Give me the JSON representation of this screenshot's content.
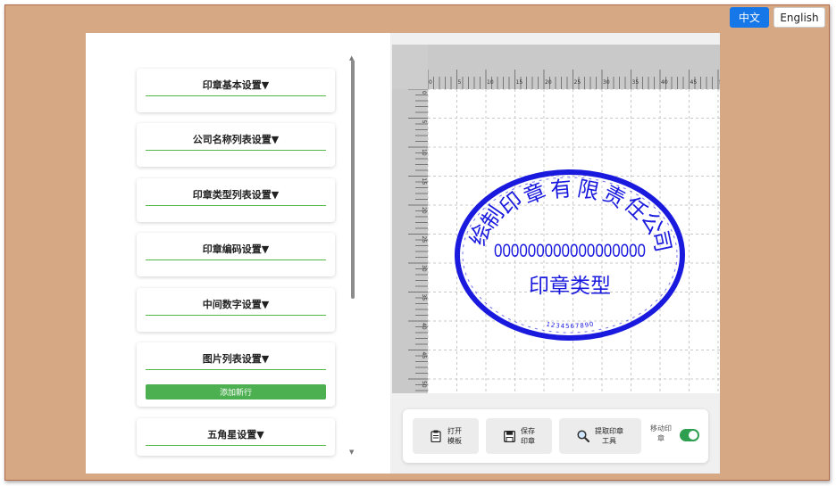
{
  "lang": {
    "zh": "中文",
    "en": "English"
  },
  "sections": [
    {
      "title": "印章基本设置▼"
    },
    {
      "title": "公司名称列表设置▼"
    },
    {
      "title": "印章类型列表设置▼"
    },
    {
      "title": "印章编码设置▼"
    },
    {
      "title": "中间数字设置▼"
    },
    {
      "title": "图片列表设置▼",
      "button": "添加新行"
    },
    {
      "title": "五角星设置▼"
    }
  ],
  "ruler": {
    "top_ticks": [
      "0",
      "5",
      "10",
      "15",
      "20",
      "25",
      "30",
      "35",
      "40",
      "45",
      "5"
    ],
    "left_ticks": [
      "0",
      "5",
      "10",
      "15",
      "20",
      "25",
      "30",
      "35",
      "40",
      "45",
      "50"
    ]
  },
  "stamp": {
    "company_chars": [
      "绘",
      "制",
      "印",
      "章",
      "有",
      "限",
      "责",
      "任",
      "公",
      "司"
    ],
    "code": "000000000000000000",
    "type": "印章类型",
    "bottom_code": "1234567890",
    "color": "#1a1adf"
  },
  "toolbar": {
    "open": "打开\n模板",
    "save": "保存\n印章",
    "extract": "提取印章\n工具",
    "move_label": "移动印\n章",
    "move_enabled": true
  },
  "colors": {
    "accent_blue": "#1677e8",
    "green": "#4caf50",
    "background": "#d6a884"
  }
}
